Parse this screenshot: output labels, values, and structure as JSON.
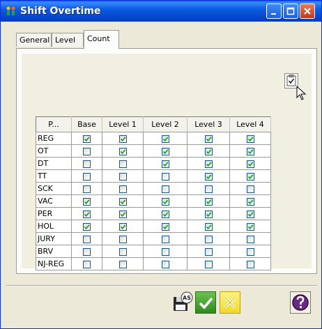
{
  "window": {
    "title": "Shift Overtime"
  },
  "tabs": [
    {
      "label": "General"
    },
    {
      "label": "Level"
    },
    {
      "label": "Count"
    }
  ],
  "active_tab": "Count",
  "grid": {
    "headers": [
      "P...",
      "Base",
      "Level 1",
      "Level 2",
      "Level 3",
      "Level 4"
    ],
    "rows": [
      {
        "label": "REG",
        "checks": [
          true,
          true,
          true,
          true,
          true
        ]
      },
      {
        "label": "OT",
        "checks": [
          false,
          true,
          true,
          true,
          true
        ]
      },
      {
        "label": "DT",
        "checks": [
          false,
          false,
          true,
          true,
          true
        ]
      },
      {
        "label": "TT",
        "checks": [
          false,
          false,
          false,
          true,
          true
        ]
      },
      {
        "label": "SCK",
        "checks": [
          false,
          false,
          false,
          false,
          false
        ]
      },
      {
        "label": "VAC",
        "checks": [
          true,
          true,
          true,
          true,
          true
        ]
      },
      {
        "label": "PER",
        "checks": [
          true,
          true,
          true,
          true,
          true
        ]
      },
      {
        "label": "HOL",
        "checks": [
          true,
          true,
          true,
          true,
          true
        ]
      },
      {
        "label": "JURY",
        "checks": [
          false,
          false,
          false,
          false,
          false
        ]
      },
      {
        "label": "BRV",
        "checks": [
          false,
          false,
          false,
          false,
          false
        ]
      },
      {
        "label": "NJ-REG",
        "checks": [
          false,
          false,
          false,
          false,
          false
        ]
      }
    ]
  },
  "buttons": {
    "save_as_badge": "AS"
  },
  "colors": {
    "titlebar": "#0a5ee6",
    "panel_bg": "#f1efe2",
    "ok_green": "#3f9a2c",
    "cancel_yellow": "#f4e33a",
    "help_purple": "#7a2b8a"
  }
}
